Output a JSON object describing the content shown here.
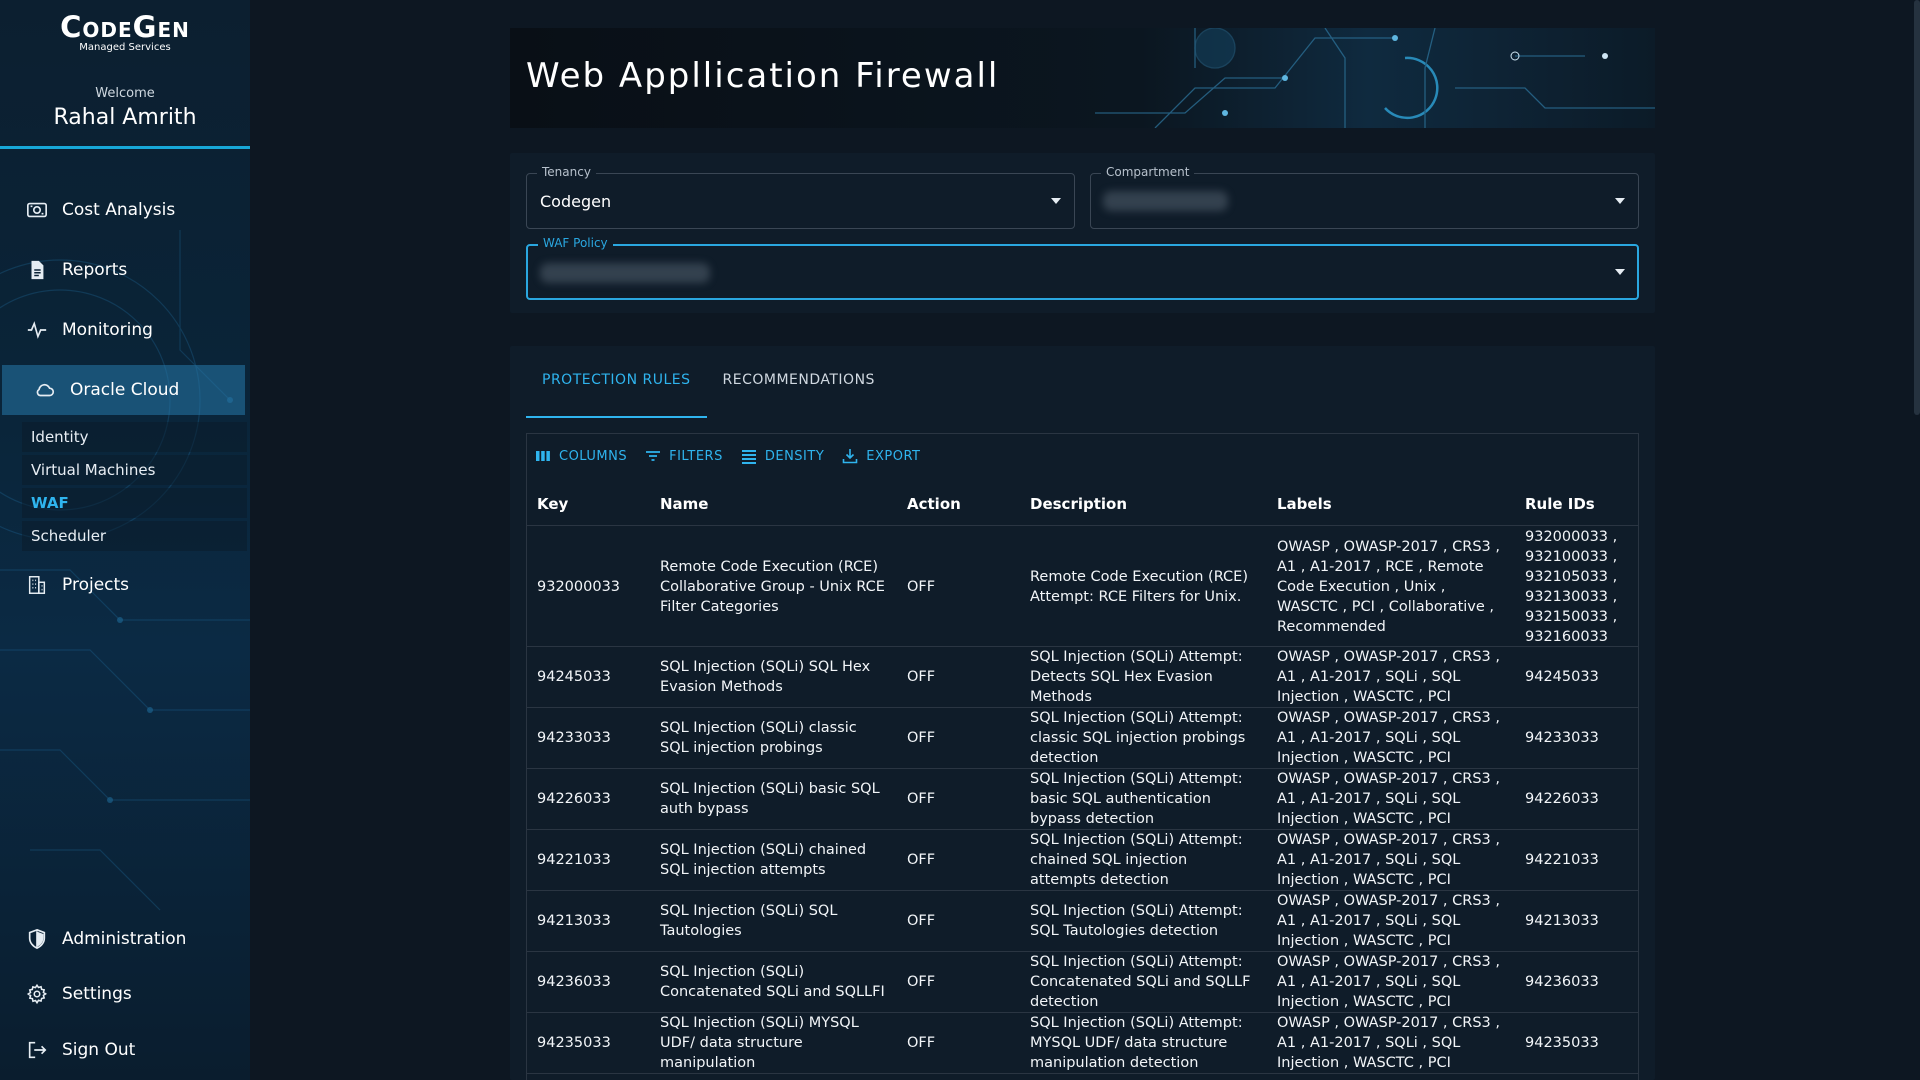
{
  "brand": {
    "name": "CodeGen",
    "tagline": "Managed Services"
  },
  "user": {
    "welcome": "Welcome",
    "name": "Rahal Amrith"
  },
  "sidebar": {
    "items": [
      {
        "label": "Cost Analysis",
        "icon": "money-icon"
      },
      {
        "label": "Reports",
        "icon": "document-icon"
      },
      {
        "label": "Monitoring",
        "icon": "pulse-icon"
      },
      {
        "label": "Oracle Cloud",
        "icon": "cloud-icon",
        "active": true
      },
      {
        "label": "Projects",
        "icon": "building-icon"
      }
    ],
    "subitems": [
      {
        "label": "Identity"
      },
      {
        "label": "Virtual Machines"
      },
      {
        "label": "WAF",
        "active": true
      },
      {
        "label": "Scheduler"
      }
    ],
    "bottom": [
      {
        "label": "Administration",
        "icon": "shield-icon"
      },
      {
        "label": "Settings",
        "icon": "gear-icon"
      },
      {
        "label": "Sign Out",
        "icon": "sign-out-icon"
      }
    ]
  },
  "page": {
    "title": "Web Appllication Firewall"
  },
  "filters": {
    "tenancy": {
      "label": "Tenancy",
      "value": "Codegen"
    },
    "compartment": {
      "label": "Compartment",
      "value": ""
    },
    "waf_policy": {
      "label": "WAF Policy",
      "value": ""
    }
  },
  "tabs": [
    {
      "label": "PROTECTION RULES",
      "active": true
    },
    {
      "label": "RECOMMENDATIONS",
      "active": false
    }
  ],
  "toolbar": {
    "columns": "COLUMNS",
    "filters": "FILTERS",
    "density": "DENSITY",
    "export": "EXPORT"
  },
  "table": {
    "columns": [
      "Key",
      "Name",
      "Action",
      "Description",
      "Labels",
      "Rule IDs"
    ],
    "rows": [
      {
        "key": "932000033",
        "name": "Remote Code Execution (RCE) Collaborative Group - Unix RCE Filter Categories",
        "action": "OFF",
        "description": "Remote Code Execution (RCE) Attempt: RCE Filters for Unix.",
        "labels": "OWASP , OWASP-2017 , CRS3 , A1 , A1-2017 , RCE , Remote Code Execution , Unix , WASCTC , PCI , Collaborative , Recommended",
        "rule_ids": "932000033 , 932100033 , 932105033 , 932130033 , 932150033 , 932160033"
      },
      {
        "key": "94245033",
        "name": "SQL Injection (SQLi) SQL Hex Evasion Methods",
        "action": "OFF",
        "description": "SQL Injection (SQLi) Attempt: Detects SQL Hex Evasion Methods",
        "labels": "OWASP , OWASP-2017 , CRS3 , A1 , A1-2017 , SQLi , SQL Injection , WASCTC , PCI",
        "rule_ids": "94245033"
      },
      {
        "key": "94233033",
        "name": "SQL Injection (SQLi) classic SQL injection probings",
        "action": "OFF",
        "description": "SQL Injection (SQLi) Attempt: classic SQL injection probings detection",
        "labels": "OWASP , OWASP-2017 , CRS3 , A1 , A1-2017 , SQLi , SQL Injection , WASCTC , PCI",
        "rule_ids": "94233033"
      },
      {
        "key": "94226033",
        "name": "SQL Injection (SQLi) basic SQL auth bypass",
        "action": "OFF",
        "description": "SQL Injection (SQLi) Attempt: basic SQL authentication bypass detection",
        "labels": "OWASP , OWASP-2017 , CRS3 , A1 , A1-2017 , SQLi , SQL Injection , WASCTC , PCI",
        "rule_ids": "94226033"
      },
      {
        "key": "94221033",
        "name": "SQL Injection (SQLi) chained SQL injection attempts",
        "action": "OFF",
        "description": "SQL Injection (SQLi) Attempt: chained SQL injection attempts detection",
        "labels": "OWASP , OWASP-2017 , CRS3 , A1 , A1-2017 , SQLi , SQL Injection , WASCTC , PCI",
        "rule_ids": "94221033"
      },
      {
        "key": "94213033",
        "name": "SQL Injection (SQLi) SQL Tautologies",
        "action": "OFF",
        "description": "SQL Injection (SQLi) Attempt: SQL Tautologies detection",
        "labels": "OWASP , OWASP-2017 , CRS3 , A1 , A1-2017 , SQLi , SQL Injection , WASCTC , PCI",
        "rule_ids": "94213033"
      },
      {
        "key": "94236033",
        "name": "SQL Injection (SQLi) Concatenated SQLi and SQLLFI",
        "action": "OFF",
        "description": "SQL Injection (SQLi) Attempt: Concatenated SQLi and SQLLF detection",
        "labels": "OWASP , OWASP-2017 , CRS3 , A1 , A1-2017 , SQLi , SQL Injection , WASCTC , PCI",
        "rule_ids": "94236033"
      },
      {
        "key": "94235033",
        "name": "SQL Injection (SQLi) MYSQL UDF/ data structure manipulation",
        "action": "OFF",
        "description": "SQL Injection (SQLi) Attempt: MYSQL UDF/ data structure manipulation detection",
        "labels": "OWASP , OWASP-2017 , CRS3 , A1 , A1-2017 , SQLi , SQL Injection , WASCTC , PCI",
        "rule_ids": "94235033"
      }
    ]
  },
  "colors": {
    "accent": "#2fb4ee",
    "background": "#0d1722",
    "card": "#0f1c29"
  }
}
